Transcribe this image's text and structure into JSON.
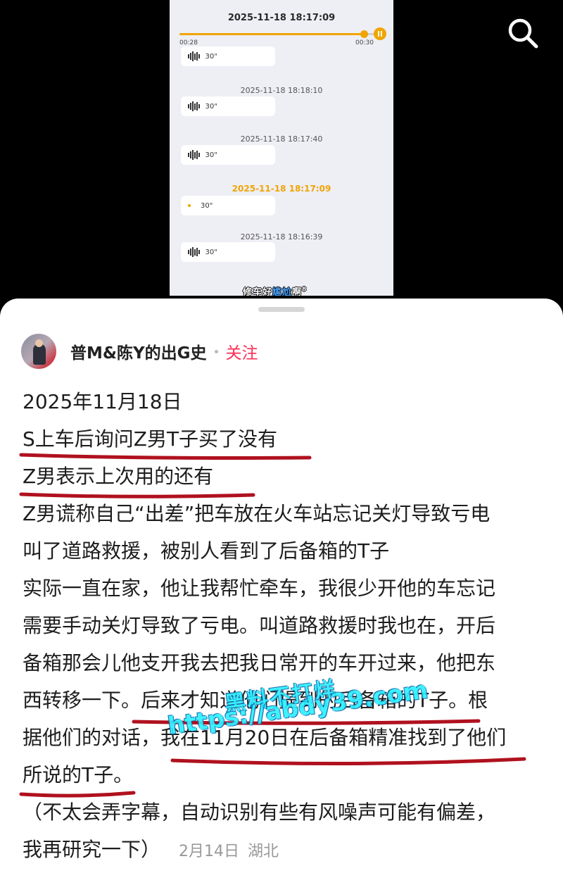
{
  "top": {
    "search_icon": "search-icon",
    "player": {
      "current_timestamp": "2025-11-18 18:17:09",
      "elapsed": "00:28",
      "total": "00:30",
      "progress": 0.93
    },
    "messages": [
      {
        "time": "",
        "duration": "30\""
      },
      {
        "time": "2025-11-18 18:18:10",
        "duration": "30\""
      },
      {
        "time": "2025-11-18 18:17:40",
        "duration": "30\""
      },
      {
        "time": "2025-11-18 18:17:09",
        "duration": "30\"",
        "playing": true
      },
      {
        "time": "2025-11-18 18:16:39",
        "duration": "30\""
      }
    ],
    "caption": {
      "pre": "修车好",
      "highlight": "尴尬",
      "post": "啊",
      "tail": "8"
    }
  },
  "post": {
    "author": "普M&陈Y的出G史",
    "follow_label": "关注",
    "lines": [
      "2025年11月18日",
      "S上车后询问Z男T子买了没有",
      "Z男表示上次用的还有",
      "Z男谎称自己“出差”把车放在火车站忘记关灯导致亏电",
      "叫了道路救援，被别人看到了后备箱的T子",
      "实际一直在家，他让我帮忙牵车，我很少开他的车忘记",
      "需要手动关灯导致了亏电。叫道路救援时我也在，开后",
      "备箱那会儿他支开我去把我日常开的车开过来，他把东",
      "西转移一下。后来才知道他们提到的后备箱的T子。根",
      "据他们的对话，我在11月20日在后备箱精准找到了他们",
      "所说的T子。",
      "（不太会弄字幕，自动识别有些有风噪声可能有偏差，",
      "我再研究一下）"
    ],
    "date": "2月14日",
    "location": "湖北"
  },
  "watermark": {
    "line1": "黑料不打烊",
    "line2": "https://abdy39.com"
  },
  "colors": {
    "accent_orange": "#f0a500",
    "follow_red": "#ff2d55",
    "underline_red": "#b0111e",
    "watermark_cyan": "#2ef0ff"
  }
}
